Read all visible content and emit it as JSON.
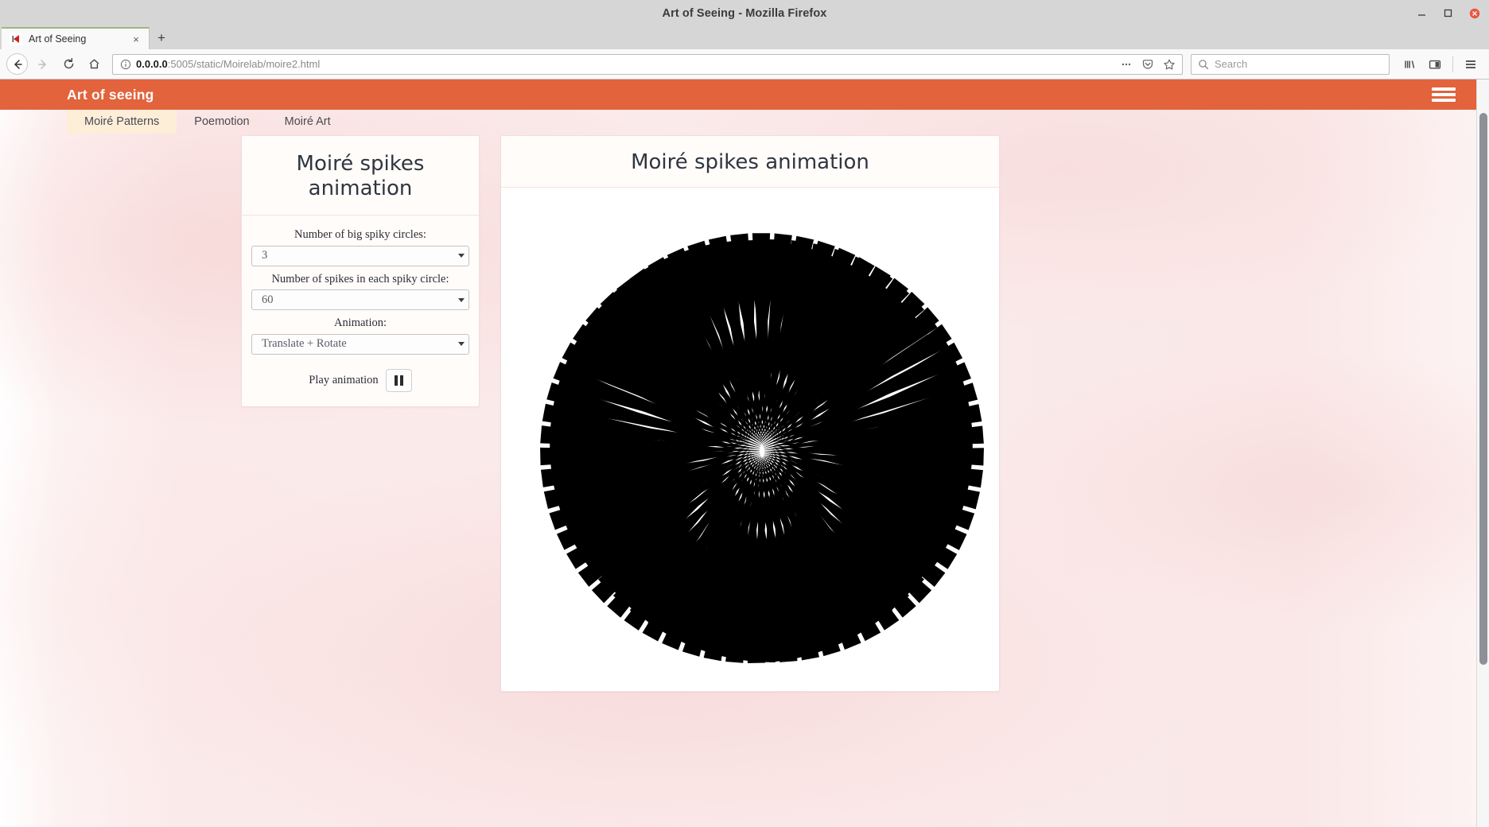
{
  "window": {
    "title": "Art of Seeing - Mozilla Firefox",
    "minimize_icon": "minimize-icon",
    "maximize_icon": "maximize-icon",
    "close_icon": "close-icon"
  },
  "tabs": {
    "items": [
      {
        "label": "Art of Seeing",
        "favicon": "firefox-page-icon",
        "close": "×"
      }
    ],
    "new_tab_label": "+"
  },
  "toolbar": {
    "back_icon": "back-arrow-icon",
    "forward_icon": "forward-arrow-icon",
    "reload_icon": "reload-icon",
    "home_icon": "home-icon",
    "url_prefix": "0.0.0.0",
    "url_rest": ":5005/static/Moirelab/moire2.html",
    "url_full": "0.0.0.0:5005/static/Moirelab/moire2.html",
    "info_icon": "page-info-icon",
    "page_actions_icon": "ellipsis-icon",
    "pocket_icon": "pocket-icon",
    "bookmark_icon": "star-icon",
    "search_placeholder": "Search",
    "search_icon": "search-icon",
    "library_icon": "library-icon",
    "sidebar_icon": "sidebar-icon",
    "menu_icon": "hamburger-menu-icon"
  },
  "site": {
    "brand": "Art of seeing",
    "brand_color": "#e2633c",
    "menu_icon": "hamburger-menu-icon",
    "nav": [
      {
        "label": "Moiré Patterns",
        "active": true
      },
      {
        "label": "Poemotion",
        "active": false
      },
      {
        "label": "Moiré Art",
        "active": false
      }
    ]
  },
  "panel": {
    "title": "Moiré spikes animation",
    "controls": [
      {
        "label": "Number of big spiky circles:",
        "value": "3",
        "name": "big-spiky-circles-select"
      },
      {
        "label": "Number of spikes in each spiky circle:",
        "value": "60",
        "name": "spikes-per-circle-select"
      },
      {
        "label": "Animation:",
        "value": "Translate + Rotate",
        "name": "animation-mode-select"
      }
    ],
    "play_label": "Play animation",
    "play_button_icon": "pause-icon"
  },
  "canvas": {
    "title": "Moiré spikes animation",
    "background": "#ffffff",
    "ink": "#000000"
  },
  "chart_data": {
    "type": "moire-spikes",
    "title": "Moiré spikes animation",
    "big_circles": 3,
    "spikes_per_circle": 60,
    "animation": "Translate + Rotate",
    "radius": 266,
    "center": [
      314,
      316
    ],
    "offsets": [
      [
        0,
        0
      ],
      [
        14,
        8
      ],
      [
        -12,
        9
      ]
    ],
    "rotations_deg": [
      0,
      1.6,
      -1.3
    ],
    "spike_inner_radius_ratio": 0.06,
    "spike_half_angle_deg": 2.4,
    "ink": "#000000",
    "background": "#ffffff"
  }
}
